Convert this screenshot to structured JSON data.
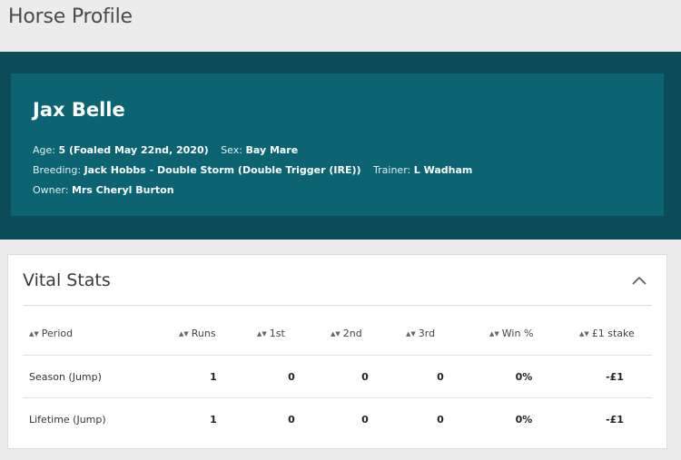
{
  "page": {
    "title": "Horse Profile"
  },
  "profile": {
    "name": "Jax Belle",
    "age_label": "Age:",
    "age_value": "5 (Foaled May 22nd, 2020)",
    "sex_label": "Sex:",
    "sex_value": "Bay Mare",
    "breeding_label": "Breeding:",
    "breeding_value": "Jack Hobbs - Double Storm (Double Trigger (IRE))",
    "trainer_label": "Trainer:",
    "trainer_value": "L Wadham",
    "owner_label": "Owner:",
    "owner_value": "Mrs Cheryl Burton"
  },
  "vital_stats": {
    "title": "Vital Stats",
    "collapse_icon": "chevron-up-icon",
    "sort_icon": "sort-arrows-icon",
    "columns": [
      "Period",
      "Runs",
      "1st",
      "2nd",
      "3rd",
      "Win %",
      "£1 stake"
    ],
    "rows": [
      {
        "period": "Season (Jump)",
        "runs": "1",
        "first": "0",
        "second": "0",
        "third": "0",
        "win_pct": "0%",
        "stake": "-£1"
      },
      {
        "period": "Lifetime (Jump)",
        "runs": "1",
        "first": "0",
        "second": "0",
        "third": "0",
        "win_pct": "0%",
        "stake": "-£1"
      }
    ]
  },
  "colors": {
    "band": "#0b4c58",
    "card": "#0c6372",
    "page_bg": "#ececec"
  }
}
